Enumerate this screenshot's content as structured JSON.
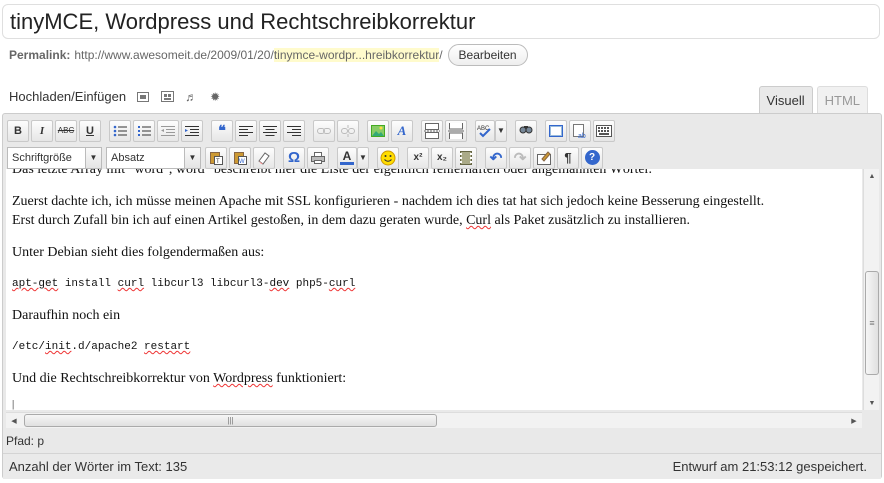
{
  "post": {
    "title": "tinyMCE, Wordpress und Rechtschreibkorrektur",
    "permalink_label": "Permalink:",
    "permalink_base": "http://www.awesomeit.de/2009/01/20/",
    "permalink_slug": "tinymce-wordpr...hreibkorrektur",
    "permalink_trailing": "/",
    "edit_label": "Bearbeiten"
  },
  "media": {
    "upload_label": "Hochladen/Einfügen",
    "icons": [
      "add-image-icon",
      "add-video-icon",
      "add-audio-icon",
      "add-media-icon"
    ]
  },
  "tabs": {
    "visual": "Visuell",
    "html": "HTML"
  },
  "toolbar": {
    "bold": "B",
    "italic": "I",
    "strike": "ABC",
    "underline": "U",
    "blockquote": "❝",
    "font_size": "Schriftgröße",
    "format": "Absatz",
    "omega": "Ω",
    "text_color": "A",
    "superscript": "x²",
    "subscript": "x₂",
    "pilcrow": "¶",
    "help": "?",
    "undo": "↶",
    "redo": "↷"
  },
  "content": {
    "line0": "Das letzte Array mit \"word\", word\" beschreibt hier die Liste der eigentlich fehlerhaften oder angemahnten Wörter.",
    "para1_a": "Zuerst dachte ich, ich müsse meinen Apache mit SSL konfigurieren - nachdem ich dies tat hat sich jedoch keine Besserung eingestellt.",
    "para1_b_pre": "Erst durch Zufall bin ich auf einen Artikel gestoßen, in dem dazu geraten wurde, ",
    "para1_b_curl": "Curl",
    "para1_b_post": " als Paket zusätzlich zu installieren.",
    "para2": "Unter Debian sieht dies folgendermaßen aus:",
    "code1_a": "apt-get",
    "code1_b": " install ",
    "code1_c": "curl",
    "code1_d": " libcurl3 libcurl3-",
    "code1_e": "dev",
    "code1_f": " php5-",
    "code1_g": "curl",
    "para3": "Daraufhin noch ein",
    "code2_a": "/etc/",
    "code2_b": "init",
    "code2_c": ".d/apache2 ",
    "code2_d": "restart",
    "para4_a": "Und die Rechtschreibkorrektur von ",
    "para4_b": "Wordpress",
    "para4_c": " funktioniert:",
    "cursor": "|"
  },
  "path": {
    "label": "Pfad:",
    "value": "p"
  },
  "status": {
    "word_count": "Anzahl der Wörter im Text: 135",
    "draft_saved": "Entwurf am 21:53:12 gespeichert."
  }
}
